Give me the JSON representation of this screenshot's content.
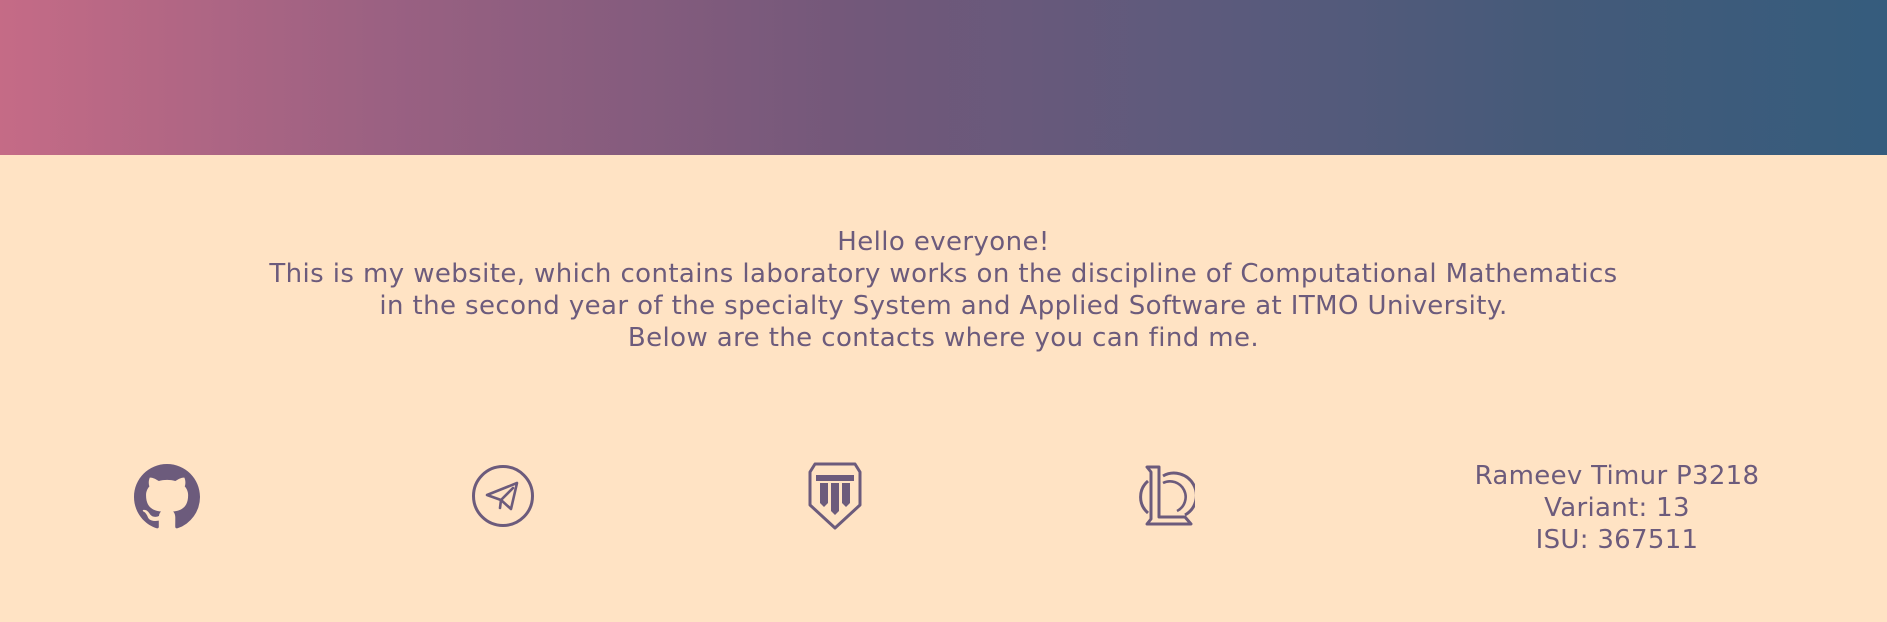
{
  "header": {
    "gradient_start": "#c56b86",
    "gradient_end": "#355c7d"
  },
  "intro": {
    "greeting": "Hello everyone!",
    "line1": "This is my website, which contains laboratory works on the discipline of Computational Mathematics",
    "line2": "in the second year of the specialty System and Applied Software at ITMO University.",
    "line3": "Below are the contacts where you can find me."
  },
  "contacts": {
    "icons": [
      "github-icon",
      "telegram-icon",
      "world-of-tanks-icon",
      "league-of-legends-icon"
    ]
  },
  "student": {
    "name": "Rameev Timur P3218",
    "variant": "Variant: 13",
    "isu": "ISU: 367511"
  },
  "colors": {
    "background": "#ffe3c4",
    "text": "#6c5b7c"
  }
}
